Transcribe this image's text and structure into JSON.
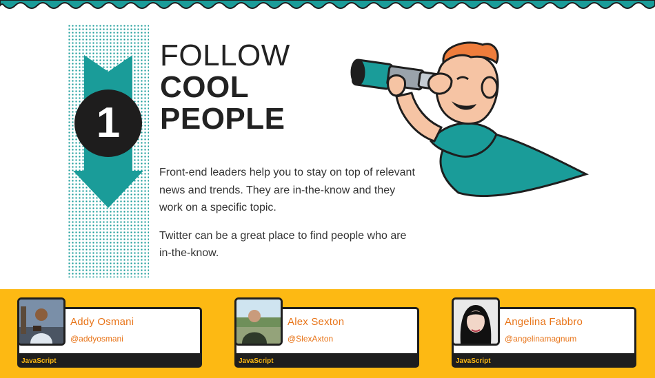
{
  "step": {
    "number": "1"
  },
  "heading": {
    "line1": "FOLLOW",
    "line2": "COOL",
    "line3": "PEOPLE"
  },
  "copy": {
    "p1": "Front-end leaders help you to stay on top of relevant news and trends. They are in-the-know and they work on a specific topic.",
    "p2": "Twitter can be a great place to find people who are in-the-know."
  },
  "colors": {
    "teal": "#1a9c99",
    "yellow": "#fdb913",
    "dark": "#1e1e1e",
    "orange": "#e8751a"
  },
  "people": [
    {
      "name": "Addy Osmani",
      "handle": "@addyosmani",
      "tag": "JavaScript"
    },
    {
      "name": "Alex Sexton",
      "handle": "@SlexAxton",
      "tag": "JavaScript"
    },
    {
      "name": "Angelina Fabbro",
      "handle": "@angelinamagnum",
      "tag": "JavaScript"
    }
  ]
}
